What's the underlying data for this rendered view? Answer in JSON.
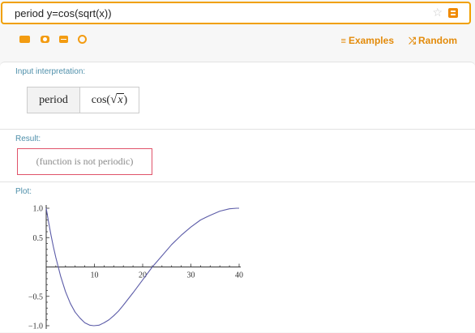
{
  "search": {
    "query": "period y=cos(sqrt(x))"
  },
  "toolbar": {
    "examples_label": "Examples",
    "random_label": "Random",
    "icons": [
      "keyboard-icon",
      "camera-icon",
      "data-icon",
      "random-input-icon"
    ]
  },
  "pods": {
    "input": {
      "title": "Input interpretation:",
      "cell1": "period",
      "cell2_prefix": "cos(",
      "cell2_var": "x",
      "cell2_suffix": ")"
    },
    "result": {
      "title": "Result:",
      "text": "(function is not periodic)"
    },
    "plot": {
      "title": "Plot:"
    }
  },
  "colors": {
    "accent": "#f08a00",
    "link": "#e38b0b",
    "pod_title": "#4e8faa",
    "result_border": "#e0536a",
    "curve": "#5c5ca8"
  },
  "chart_data": {
    "type": "line",
    "title": "",
    "xlabel": "",
    "ylabel": "",
    "xlim": [
      0,
      40
    ],
    "ylim": [
      -1.0,
      1.0
    ],
    "x_ticks": [
      10,
      20,
      30,
      40
    ],
    "y_ticks": [
      1.0,
      0.5,
      -0.5,
      -1.0
    ],
    "y_tick_labels": [
      "1.0",
      "0.5",
      "−0.5",
      "−1.0"
    ],
    "series": [
      {
        "x": [
          0,
          0.5,
          1,
          1.5,
          2,
          2.5,
          3,
          4,
          5,
          6,
          7,
          8,
          9,
          9.87,
          11,
          12,
          13,
          14,
          15,
          16,
          18,
          20,
          22,
          24,
          26,
          28,
          30,
          32,
          34,
          36,
          38,
          39.48,
          40
        ],
        "y": [
          1.0,
          0.76,
          0.54,
          0.34,
          0.16,
          0.0,
          -0.16,
          -0.42,
          -0.62,
          -0.77,
          -0.87,
          -0.95,
          -0.99,
          -1.0,
          -0.99,
          -0.95,
          -0.9,
          -0.83,
          -0.75,
          -0.65,
          -0.44,
          -0.22,
          0.0,
          0.19,
          0.38,
          0.54,
          0.68,
          0.8,
          0.88,
          0.95,
          0.99,
          1.0,
          1.0
        ]
      }
    ]
  }
}
